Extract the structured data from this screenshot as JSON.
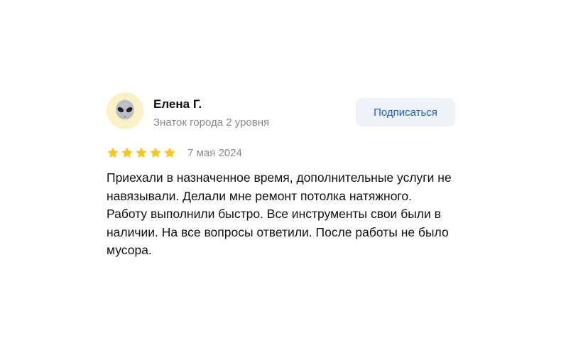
{
  "review": {
    "author": {
      "avatar_icon": "alien-emoji-icon",
      "name": "Елена Г.",
      "level": "Знаток города 2 уровня"
    },
    "subscribe_label": "Подписаться",
    "rating": {
      "value": 5,
      "max": 5,
      "star_color": "#fcc521"
    },
    "date": "7 мая 2024",
    "text": "Приехали в назначенное время, дополнительные услуги не навязывали. Делали мне ремонт потолка натяжного. Работу выполнили быстро. Все инструменты свои были в наличии. На все вопросы ответили. После работы не было мусора."
  },
  "colors": {
    "accent": "#1c5fd0",
    "button_bg": "#eef3f9",
    "muted_text": "#8a8a8a",
    "avatar_bg": "#fbf0c6"
  }
}
